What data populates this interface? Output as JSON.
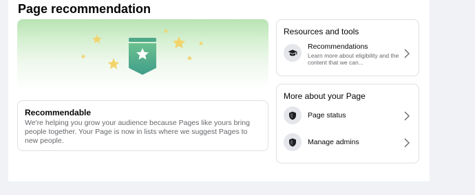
{
  "page": {
    "title": "Page recommendation"
  },
  "recommendable_card": {
    "title": "Recommendable",
    "description": "We're helping you grow your audience because Pages like yours bring people together. Your Page is now in lists where we suggest Pages to new people."
  },
  "resources_card": {
    "heading": "Resources and tools",
    "items": [
      {
        "icon": "graduation-cap-icon",
        "label": "Recommendations",
        "description": "Learn more about eligibility and the content that we can..."
      }
    ]
  },
  "about_card": {
    "heading": "More about your Page",
    "items": [
      {
        "icon": "shield-icon",
        "label": "Page status"
      },
      {
        "icon": "shield-icon",
        "label": "Manage admins"
      }
    ]
  },
  "colors": {
    "banner_green": "#b8e3b3",
    "badge_green": "#5fb58a",
    "star_yellow": "#f2d46b",
    "secondary_text": "#65676b",
    "icon_bg": "#e4e6eb"
  }
}
